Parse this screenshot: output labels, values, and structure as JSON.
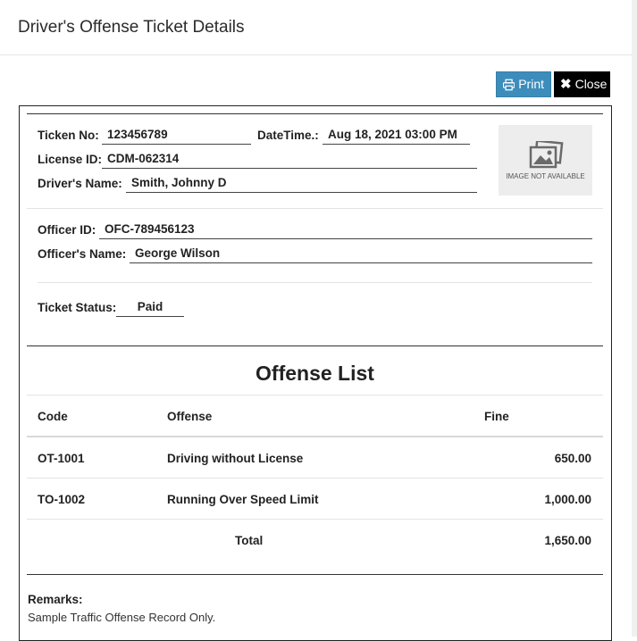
{
  "modal": {
    "title": "Driver's Offense Ticket Details",
    "print_label": "Print",
    "close_label": "Close"
  },
  "ticket": {
    "ticket_no_label": "Ticken No:",
    "ticket_no": "123456789",
    "datetime_label": "DateTime.:",
    "datetime": "Aug 18, 2021 03:00 PM",
    "license_label": "License ID:",
    "license_id": "CDM-062314",
    "driver_label": "Driver's Name:",
    "driver_name": "Smith, Johnny D",
    "officer_id_label": "Officer ID:",
    "officer_id": "OFC-789456123",
    "officer_name_label": "Officer's Name:",
    "officer_name": "George Wilson",
    "status_label": "Ticket Status:",
    "status": "Paid",
    "photo_placeholder": "IMAGE NOT AVAILABLE"
  },
  "offense_list": {
    "title": "Offense List",
    "headers": [
      "Code",
      "Offense",
      "Fine"
    ],
    "rows": [
      {
        "code": "OT-1001",
        "offense": "Driving without License",
        "fine": "650.00"
      },
      {
        "code": "TO-1002",
        "offense": "Running Over Speed Limit",
        "fine": "1,000.00"
      }
    ],
    "total_label": "Total",
    "total": "1,650.00"
  },
  "remarks": {
    "label": "Remarks:",
    "text": "Sample Traffic Offense Record Only."
  },
  "colors": {
    "print_button": "#3c8dbc",
    "close_button": "#000000"
  }
}
